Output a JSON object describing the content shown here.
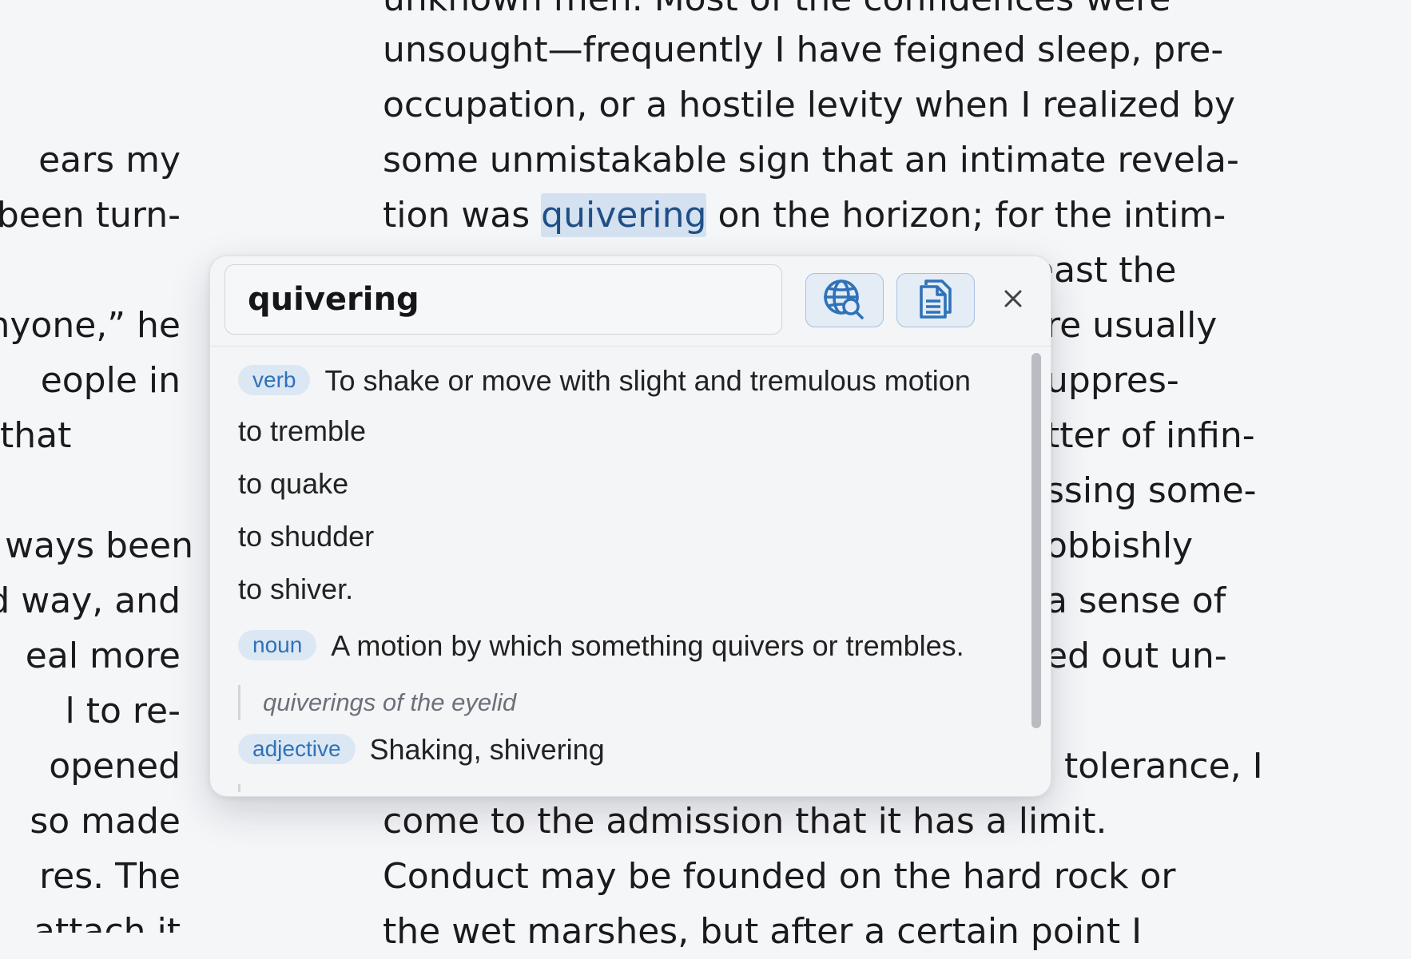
{
  "reader": {
    "left_column": [
      "ears my",
      "been turn-",
      "",
      "nyone,” he",
      "eople in",
      " that",
      "",
      "ways been",
      "d way, and",
      "eal more",
      "l to re-",
      "opened",
      "so made",
      "res. The",
      "attach it"
    ],
    "right_column": [
      "unknown men. Most of the confidences were",
      "unsought—frequently I have feigned sleep, pre-",
      "occupation, or a hostile levity when I realized by",
      "some unmistakable sign that an intimate revela-",
      "tion was",
      "quivering",
      "on the horizon; for the intim-",
      "east the",
      "re usually",
      "uppres-",
      "tter of infin-",
      "ssing some-",
      "obbishly",
      "a sense of",
      "ed out un-",
      "tolerance, I",
      "come to the admission that it has a limit.",
      "Conduct may be founded on the hard rock or",
      "the wet marshes, but after a certain point I"
    ]
  },
  "popup": {
    "query": "quivering",
    "web_search_icon": "globe-search-icon",
    "copy_icon": "copy-document-icon",
    "close_icon": "close-icon",
    "definitions": {
      "verb": {
        "pos": "verb",
        "text": "To shake or move with slight and tremulous motion",
        "senses": [
          "to tremble",
          "to quake",
          "to shudder",
          "to shiver."
        ]
      },
      "noun": {
        "pos": "noun",
        "text": "A motion by which something quivers or trembles.",
        "example": "quiverings of the eyelid"
      },
      "adjective": {
        "pos": "adjective",
        "text": "Shaking, shivering"
      }
    }
  },
  "colors": {
    "accent": "#2f72b8",
    "badge_bg": "#dce7f4",
    "highlight": "#d4e1f0",
    "background": "#f5f6f8"
  }
}
